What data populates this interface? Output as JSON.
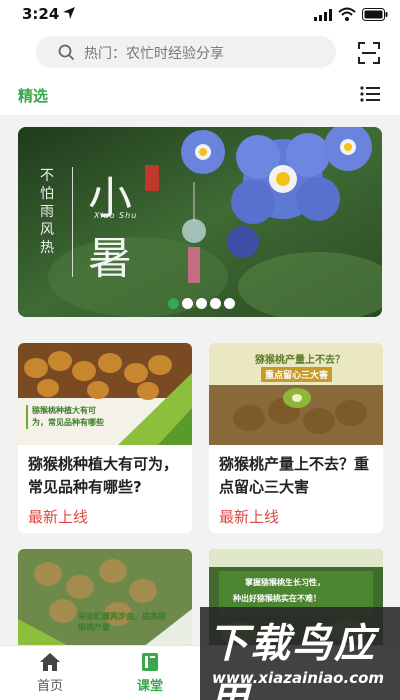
{
  "status_bar": {
    "time": "3:24"
  },
  "header": {
    "search_placeholder": "热门：农忙时经验分享",
    "featured_tab": "精选"
  },
  "banner": {
    "vertical_text": "不怕雨风热",
    "big_char_1": "小",
    "big_char_2": "暑",
    "pinyin": "Xiao Shu",
    "slides_total": 5,
    "active_slide": 1
  },
  "cards": [
    {
      "title": "猕猴桃种植大有可为，常见品种有哪些?",
      "tag": "最新上线",
      "image_overlay": "猕猴桃种植大有可为，常见品种有哪些"
    },
    {
      "title": "猕猴桃产量上不去？重点留心三大害",
      "tag": "最新上线",
      "image_overlay_1": "猕猴桃产量上不去？",
      "image_overlay_2": "重点留心三大害"
    },
    {
      "image_overlay": "采收贮藏两步曲，提高猕猴桃产量"
    },
    {
      "image_overlay_1": "掌握猕猴桃生长习性，",
      "image_overlay_2": "种出好猕猴桃实在不难！"
    }
  ],
  "bottom_nav": {
    "home": "首页",
    "classroom": "课堂"
  },
  "watermark": {
    "title": "下载鸟应用",
    "url": "www.xiazainiao.com"
  },
  "colors": {
    "accent": "#3aa84a",
    "tag": "#e0463f"
  }
}
